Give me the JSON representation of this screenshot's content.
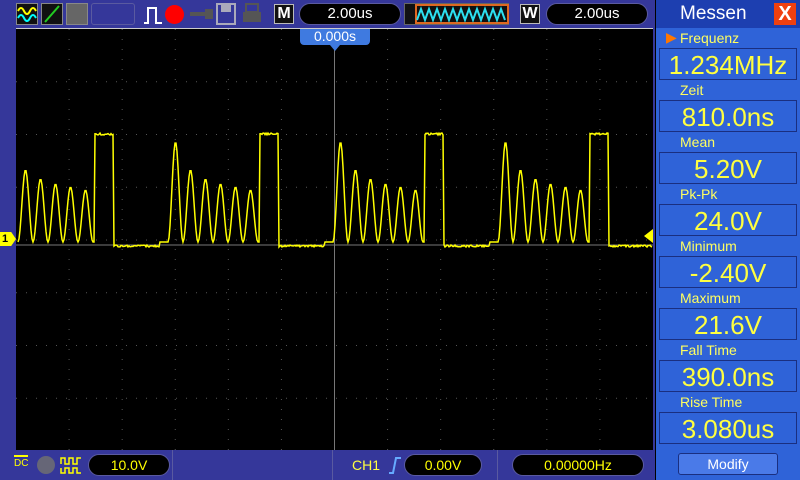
{
  "toolbar": {
    "m_label": "M",
    "m_timebase": "2.00us",
    "w_label": "W",
    "w_timebase": "2.00us",
    "trigger_pos": "0.000s"
  },
  "measure": {
    "title": "Messen",
    "close": "X",
    "items": [
      {
        "label": "Frequenz",
        "value": "1.234MHz"
      },
      {
        "label": "Zeit",
        "value": "810.0ns"
      },
      {
        "label": "Mean",
        "value": "5.20V"
      },
      {
        "label": "Pk-Pk",
        "value": "24.0V"
      },
      {
        "label": "Minimum",
        "value": "-2.40V"
      },
      {
        "label": "Maximum",
        "value": "21.6V"
      },
      {
        "label": "Fall  Time",
        "value": "390.0ns"
      },
      {
        "label": "Rise  Time",
        "value": "3.080us"
      }
    ],
    "modify": "Modify"
  },
  "bottom": {
    "coupling": "DC",
    "volts_div": "10.0V",
    "trig_source": "CH1",
    "trig_level": "0.00V",
    "frequency": "0.00000Hz"
  },
  "channel_marker": "1",
  "colors": {
    "trace": "#ffff00",
    "panel": "#2f63d8",
    "bar": "#35379a"
  }
}
